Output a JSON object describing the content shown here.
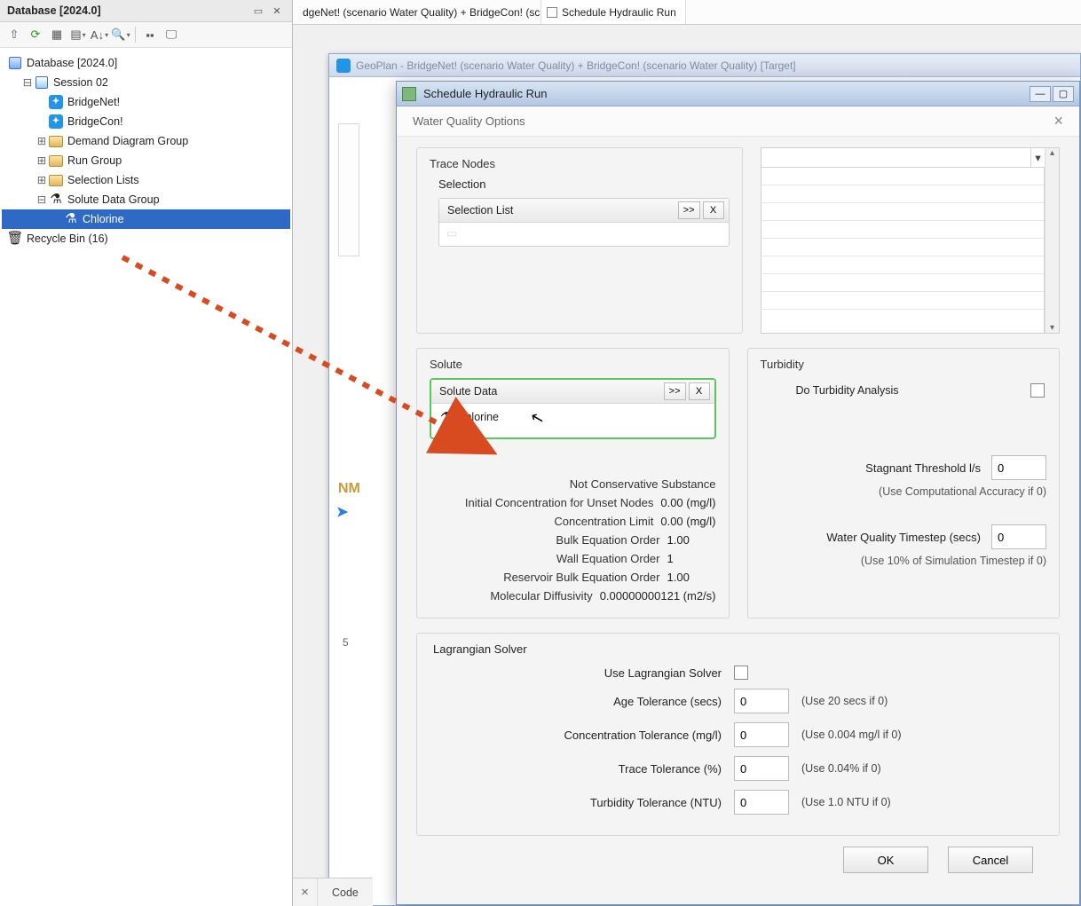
{
  "db_panel": {
    "title": "Database [2024.0]",
    "tree": {
      "root": "Database [2024.0]",
      "session": "Session 02",
      "net": "BridgeNet!",
      "con": "BridgeCon!",
      "demand": "Demand Diagram Group",
      "run": "Run Group",
      "sel_lists": "Selection Lists",
      "solute_group": "Solute Data Group",
      "chlorine": "Chlorine",
      "bin": "Recycle Bin (16)"
    }
  },
  "doc_tabs": {
    "tab1": "dgeNet! (scenario Water Quality)  + BridgeCon! (scenario Water Qualit",
    "tab2": "Schedule Hydraulic Run"
  },
  "geoplan": {
    "title": "GeoPlan - BridgeNet! (scenario Water Quality)  + BridgeCon! (scenario Water Quality)  [Target]",
    "nm": "NM",
    "five": "5"
  },
  "dlg": {
    "title": "Schedule Hydraulic Run",
    "subheader": "Water Quality Options",
    "trace": {
      "group": "Trace Nodes",
      "selection": "Selection",
      "sel_list": "Selection List",
      "expand_btn": ">>",
      "clear_btn": "X"
    },
    "solute": {
      "group": "Solute",
      "data_label": "Solute Data",
      "value": "Chlorine",
      "props": {
        "not_conservative": "Not Conservative Substance",
        "init_label": "Initial Concentration for Unset Nodes",
        "init_val": "0.00 (mg/l)",
        "conc_limit_label": "Concentration Limit",
        "conc_limit_val": "0.00 (mg/l)",
        "bulk_label": "Bulk Equation Order",
        "bulk_val": "1.00",
        "wall_label": "Wall Equation Order",
        "wall_val": "1",
        "res_bulk_label": "Reservoir Bulk Equation Order",
        "res_bulk_val": "1.00",
        "mol_label": "Molecular Diffusivity",
        "mol_val": "0.00000000121 (m2/s)"
      }
    },
    "turbidity": {
      "group": "Turbidity",
      "do_analysis": "Do Turbidity Analysis",
      "stag_label": "Stagnant Threshold l/s",
      "stag_val": "0",
      "stag_hint": "(Use Computational Accuracy if 0)",
      "ts_label": "Water Quality Timestep (secs)",
      "ts_val": "0",
      "ts_hint": "(Use 10% of Simulation Timestep if 0)"
    },
    "lagrangian": {
      "group": "Lagrangian Solver",
      "use_label": "Use Lagrangian Solver",
      "age_label": "Age Tolerance (secs)",
      "age_val": "0",
      "age_hint": "(Use 20 secs if 0)",
      "conc_label": "Concentration Tolerance (mg/l)",
      "conc_val": "0",
      "conc_hint": "(Use 0.004 mg/l if 0)",
      "trace_label": "Trace Tolerance (%)",
      "trace_val": "0",
      "trace_hint": "(Use 0.04% if 0)",
      "turb_label": "Turbidity Tolerance (NTU)",
      "turb_val": "0",
      "turb_hint": "(Use 1.0 NTU if 0)"
    },
    "buttons": {
      "ok": "OK",
      "cancel": "Cancel"
    }
  },
  "codebar": {
    "label": "Code"
  }
}
